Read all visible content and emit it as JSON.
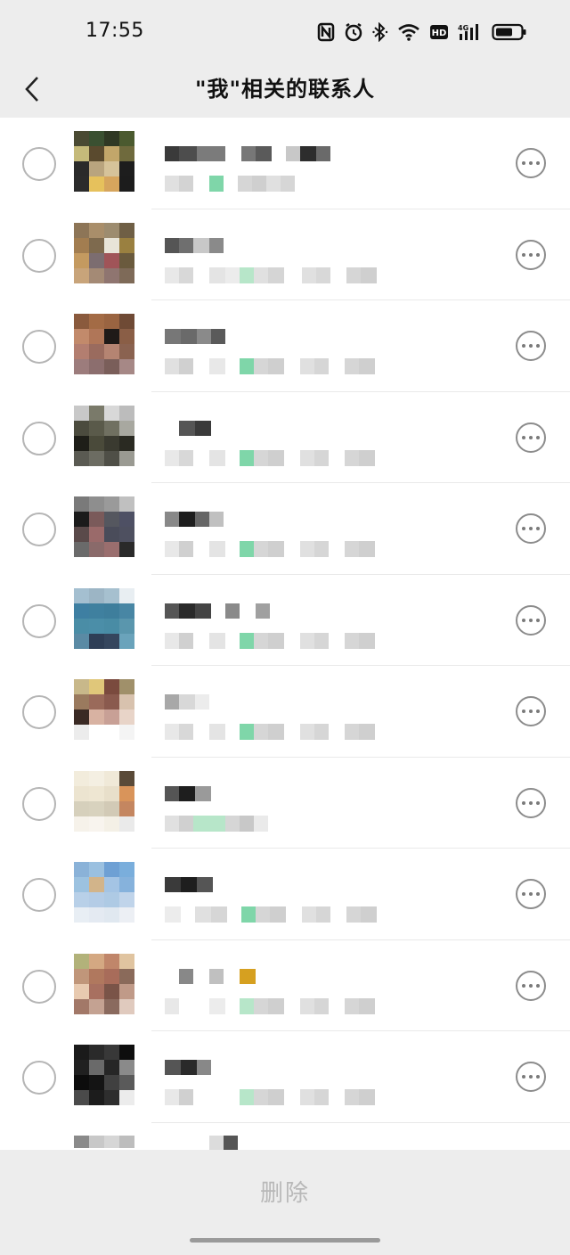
{
  "status_bar": {
    "time": "17:55",
    "icons": [
      "nfc-icon",
      "alarm-icon",
      "bluetooth-icon",
      "wifi-icon",
      "hd-icon",
      "signal-4g-icon",
      "battery-icon"
    ]
  },
  "nav": {
    "back_icon": "chevron-left-icon",
    "title": "\"我\"相关的联系人"
  },
  "contacts": [
    {
      "avatar": [
        "#4a4a33",
        "#3a5031",
        "#2f3824",
        "#4b5a2f",
        "#c5ba7a",
        "#5a4a2e",
        "#c2a66a",
        "#6f6a3d",
        "#2a2a2a",
        "#b9a47e",
        "#d6c39a",
        "#1d1d1d",
        "#2b2b2b",
        "#e6c15c",
        "#d6a55d",
        "#1c1c1c"
      ],
      "name_blocks": [
        [
          "#3a3a3a",
          16
        ],
        [
          "#4d4d4d",
          20
        ],
        [
          "#7b7b7b",
          32
        ],
        [
          "#fff",
          18
        ],
        [
          "#777",
          16
        ],
        [
          "#5a5a5a",
          18
        ],
        [
          "#fff",
          16
        ],
        [
          "#c8c8c8",
          16
        ],
        [
          "#2d2d2d",
          18
        ],
        [
          "#6a6a6a",
          16
        ]
      ],
      "msg_blocks": [
        [
          "#e0e0e0",
          16
        ],
        [
          "#d3d3d3",
          16
        ],
        [
          "#fff",
          18
        ],
        [
          "#7fd6a9",
          16
        ],
        [
          "#fff",
          16
        ],
        [
          "#d6d6d6",
          16
        ],
        [
          "#cfcfcf",
          16
        ],
        [
          "#e0e0e0",
          16
        ],
        [
          "#d6d6d6",
          16
        ]
      ]
    },
    {
      "avatar": [
        "#8d7557",
        "#a98e6a",
        "#9d8c6f",
        "#6f5f45",
        "#a27d50",
        "#7e6a4e",
        "#e8e4d8",
        "#9a8040",
        "#c49a60",
        "#7c6d70",
        "#a05458",
        "#6a5a3d",
        "#c8a47a",
        "#a48a75",
        "#8f7570",
        "#7e6a58"
      ],
      "name_blocks": [
        [
          "#555",
          16
        ],
        [
          "#6f6f6f",
          16
        ],
        [
          "#c8c8c8",
          18
        ],
        [
          "#8a8a8a",
          16
        ]
      ],
      "msg_blocks": [
        [
          "#e8e8e8",
          16
        ],
        [
          "#d8d8d8",
          16
        ],
        [
          "#fff",
          18
        ],
        [
          "#e4e4e4",
          18
        ],
        [
          "#ececec",
          16
        ],
        [
          "#b7e6c9",
          16
        ],
        [
          "#e0e0e0",
          16
        ],
        [
          "#d5d5d5",
          18
        ],
        [
          "#fff",
          20
        ],
        [
          "#e0e0e0",
          16
        ],
        [
          "#d8d8d8",
          16
        ],
        [
          "#fff",
          18
        ],
        [
          "#d6d6d6",
          16
        ],
        [
          "#cfcfcf",
          18
        ]
      ]
    },
    {
      "avatar": [
        "#8a5a3d",
        "#a36b45",
        "#9a6441",
        "#6f4a35",
        "#c28a6b",
        "#b07658",
        "#1f1a18",
        "#8a5e46",
        "#b37e70",
        "#9a6b5e",
        "#b58472",
        "#8a6250",
        "#9c7c7c",
        "#8c6e6e",
        "#7a5e5a",
        "#a68886"
      ],
      "name_blocks": [
        [
          "#777",
          18
        ],
        [
          "#6a6a6a",
          18
        ],
        [
          "#8a8a8a",
          16
        ],
        [
          "#5a5a5a",
          16
        ]
      ],
      "msg_blocks": [
        [
          "#e0e0e0",
          16
        ],
        [
          "#d0d0d0",
          16
        ],
        [
          "#fff",
          18
        ],
        [
          "#e8e8e8",
          18
        ],
        [
          "#fff",
          16
        ],
        [
          "#7fd6a9",
          16
        ],
        [
          "#d6d6d6",
          16
        ],
        [
          "#cfcfcf",
          18
        ],
        [
          "#fff",
          18
        ],
        [
          "#e0e0e0",
          16
        ],
        [
          "#d6d6d6",
          16
        ],
        [
          "#fff",
          18
        ],
        [
          "#d6d6d6",
          16
        ],
        [
          "#cfcfcf",
          18
        ]
      ]
    },
    {
      "avatar": [
        "#c8c8c8",
        "#7a7a6a",
        "#d8d8d8",
        "#bcbcbc",
        "#4b4b3e",
        "#5a5a4a",
        "#707061",
        "#a8a8a0",
        "#1e1e18",
        "#4a4a3a",
        "#3a3a30",
        "#2a2a22",
        "#5a5a52",
        "#6c6c62",
        "#4f4f47",
        "#9a9a92"
      ],
      "name_blocks": [
        [
          "#fff",
          16
        ],
        [
          "#555",
          18
        ],
        [
          "#3a3a3a",
          18
        ]
      ],
      "msg_blocks": [
        [
          "#e8e8e8",
          16
        ],
        [
          "#d8d8d8",
          16
        ],
        [
          "#fff",
          18
        ],
        [
          "#e4e4e4",
          18
        ],
        [
          "#fff",
          16
        ],
        [
          "#7fd6a9",
          16
        ],
        [
          "#d6d6d6",
          16
        ],
        [
          "#cfcfcf",
          18
        ],
        [
          "#fff",
          18
        ],
        [
          "#e0e0e0",
          16
        ],
        [
          "#d6d6d6",
          16
        ],
        [
          "#fff",
          18
        ],
        [
          "#d6d6d6",
          16
        ],
        [
          "#cfcfcf",
          18
        ]
      ]
    },
    {
      "avatar": [
        "#7a7a7a",
        "#8e8e8e",
        "#9a9a9a",
        "#c0c0c0",
        "#1b1b1b",
        "#7a5a5a",
        "#55575f",
        "#4e5064",
        "#5a4a4a",
        "#9a6a6a",
        "#4a4c5a",
        "#4e5060",
        "#6a6a6a",
        "#8a6a6a",
        "#9a6e6e",
        "#2a2a2a"
      ],
      "name_blocks": [
        [
          "#888",
          16
        ],
        [
          "#1e1e1e",
          18
        ],
        [
          "#666",
          16
        ],
        [
          "#c0c0c0",
          16
        ]
      ],
      "msg_blocks": [
        [
          "#e8e8e8",
          16
        ],
        [
          "#d0d0d0",
          16
        ],
        [
          "#fff",
          18
        ],
        [
          "#e4e4e4",
          18
        ],
        [
          "#fff",
          16
        ],
        [
          "#7fd6a9",
          16
        ],
        [
          "#d6d6d6",
          16
        ],
        [
          "#cfcfcf",
          18
        ],
        [
          "#fff",
          18
        ],
        [
          "#e0e0e0",
          16
        ],
        [
          "#d6d6d6",
          16
        ],
        [
          "#fff",
          18
        ],
        [
          "#d6d6d6",
          16
        ],
        [
          "#cfcfcf",
          18
        ]
      ]
    },
    {
      "avatar": [
        "#a4bfd0",
        "#9cb5c5",
        "#a6c0cf",
        "#e8eef2",
        "#3e7fa2",
        "#3f809f",
        "#3e7e9c",
        "#4886a4",
        "#4a8da6",
        "#4b8ea8",
        "#498ca5",
        "#5a96ad",
        "#5a8aa4",
        "#2e3e56",
        "#35465e",
        "#6aa3bb"
      ],
      "name_blocks": [
        [
          "#555",
          16
        ],
        [
          "#2a2a2a",
          18
        ],
        [
          "#444",
          18
        ],
        [
          "#fff",
          16
        ],
        [
          "#8a8a8a",
          16
        ],
        [
          "#fff",
          18
        ],
        [
          "#a0a0a0",
          16
        ]
      ],
      "msg_blocks": [
        [
          "#e8e8e8",
          16
        ],
        [
          "#d0d0d0",
          16
        ],
        [
          "#fff",
          18
        ],
        [
          "#e4e4e4",
          18
        ],
        [
          "#fff",
          16
        ],
        [
          "#7fd6a9",
          16
        ],
        [
          "#d6d6d6",
          16
        ],
        [
          "#cfcfcf",
          18
        ],
        [
          "#fff",
          18
        ],
        [
          "#e0e0e0",
          16
        ],
        [
          "#d6d6d6",
          16
        ],
        [
          "#fff",
          18
        ],
        [
          "#d6d6d6",
          16
        ],
        [
          "#cfcfcf",
          18
        ]
      ]
    },
    {
      "avatar": [
        "#c8b88a",
        "#e0c77a",
        "#7a4a3e",
        "#a0906a",
        "#9a7a5e",
        "#9a6a5a",
        "#8a5a4e",
        "#d8c2ae",
        "#3a2a24",
        "#d8b2a2",
        "#c8a096",
        "#e8d4c8",
        "#ececec",
        "#ffffff",
        "#ffffff",
        "#f4f4f4"
      ],
      "name_blocks": [
        [
          "#a8a8a8",
          16
        ],
        [
          "#d8d8d8",
          18
        ],
        [
          "#ececec",
          16
        ]
      ],
      "msg_blocks": [
        [
          "#e8e8e8",
          16
        ],
        [
          "#d8d8d8",
          16
        ],
        [
          "#fff",
          18
        ],
        [
          "#e4e4e4",
          18
        ],
        [
          "#fff",
          16
        ],
        [
          "#7fd6a9",
          16
        ],
        [
          "#d6d6d6",
          16
        ],
        [
          "#cfcfcf",
          18
        ],
        [
          "#fff",
          18
        ],
        [
          "#e0e0e0",
          16
        ],
        [
          "#d6d6d6",
          16
        ],
        [
          "#fff",
          18
        ],
        [
          "#d6d6d6",
          16
        ],
        [
          "#cfcfcf",
          18
        ]
      ]
    },
    {
      "avatar": [
        "#f2ecdc",
        "#f4efe2",
        "#f0e9d8",
        "#5a4a38",
        "#ece4d0",
        "#eee6d2",
        "#e8dfca",
        "#d9945a",
        "#d6d0bc",
        "#d8d2be",
        "#d2cab6",
        "#c48660",
        "#f6f2ea",
        "#f8f4ee",
        "#f4f0e6",
        "#eaeaea"
      ],
      "name_blocks": [
        [
          "#555",
          16
        ],
        [
          "#1e1e1e",
          18
        ],
        [
          "#9a9a9a",
          18
        ]
      ],
      "msg_blocks": [
        [
          "#e0e0e0",
          16
        ],
        [
          "#d0d0d0",
          16
        ],
        [
          "#b7e6c9",
          18
        ],
        [
          "#b7e6c9",
          18
        ],
        [
          "#d6d6d6",
          16
        ],
        [
          "#c8c8c8",
          16
        ],
        [
          "#eaeaea",
          16
        ]
      ]
    },
    {
      "avatar": [
        "#8ab2d8",
        "#9ac0e0",
        "#6ea0d4",
        "#7aaedc",
        "#9cc2e0",
        "#d2b48a",
        "#a4c4e4",
        "#86b2dc",
        "#b8d0e8",
        "#b4cce6",
        "#aecae4",
        "#c0d4ea",
        "#e8eef4",
        "#e4eaf2",
        "#e0e8f0",
        "#eceff4"
      ],
      "name_blocks": [
        [
          "#3a3a3a",
          18
        ],
        [
          "#1e1e1e",
          18
        ],
        [
          "#555",
          18
        ]
      ],
      "msg_blocks": [
        [
          "#ececec",
          18
        ],
        [
          "#fff",
          16
        ],
        [
          "#e0e0e0",
          18
        ],
        [
          "#d6d6d6",
          18
        ],
        [
          "#fff",
          16
        ],
        [
          "#7fd6a9",
          16
        ],
        [
          "#d6d6d6",
          16
        ],
        [
          "#cfcfcf",
          18
        ],
        [
          "#fff",
          18
        ],
        [
          "#e0e0e0",
          16
        ],
        [
          "#d6d6d6",
          16
        ],
        [
          "#fff",
          18
        ],
        [
          "#d6d6d6",
          16
        ],
        [
          "#cfcfcf",
          18
        ]
      ]
    },
    {
      "avatar": [
        "#b2b27a",
        "#d4a882",
        "#c0866a",
        "#e0c4a0",
        "#c0967a",
        "#b0785e",
        "#a86c5a",
        "#8a6a5a",
        "#e8cab0",
        "#a87060",
        "#7a5448",
        "#c09a88",
        "#a27868",
        "#c4a292",
        "#8a6a5e",
        "#e0cabe"
      ],
      "name_blocks": [
        [
          "#fff",
          16
        ],
        [
          "#888",
          16
        ],
        [
          "#fff",
          18
        ],
        [
          "#c0c0c0",
          16
        ],
        [
          "#fff",
          18
        ],
        [
          "#d6a020",
          18
        ]
      ],
      "msg_blocks": [
        [
          "#e8e8e8",
          16
        ],
        [
          "#fff",
          16
        ],
        [
          "#fff",
          18
        ],
        [
          "#ececec",
          18
        ],
        [
          "#fff",
          16
        ],
        [
          "#b7e6c9",
          16
        ],
        [
          "#d6d6d6",
          16
        ],
        [
          "#cfcfcf",
          18
        ],
        [
          "#fff",
          18
        ],
        [
          "#e0e0e0",
          16
        ],
        [
          "#d6d6d6",
          16
        ],
        [
          "#fff",
          18
        ],
        [
          "#d6d6d6",
          16
        ],
        [
          "#cfcfcf",
          18
        ]
      ]
    },
    {
      "avatar": [
        "#1a1a1a",
        "#2a2a2a",
        "#383838",
        "#0e0e0e",
        "#202020",
        "#6a6a6a",
        "#262626",
        "#8a8a8a",
        "#0c0c0c",
        "#141414",
        "#404040",
        "#5a5a5a",
        "#4a4a4a",
        "#1c1c1c",
        "#2e2e2e",
        "#ececec"
      ],
      "name_blocks": [
        [
          "#555",
          18
        ],
        [
          "#2a2a2a",
          18
        ],
        [
          "#888",
          16
        ]
      ],
      "msg_blocks": [
        [
          "#e8e8e8",
          16
        ],
        [
          "#d0d0d0",
          16
        ],
        [
          "#fff",
          18
        ],
        [
          "#fff",
          18
        ],
        [
          "#fff",
          16
        ],
        [
          "#b7e6c9",
          16
        ],
        [
          "#d6d6d6",
          16
        ],
        [
          "#cfcfcf",
          18
        ],
        [
          "#fff",
          18
        ],
        [
          "#e0e0e0",
          16
        ],
        [
          "#d6d6d6",
          16
        ],
        [
          "#fff",
          18
        ],
        [
          "#d6d6d6",
          16
        ],
        [
          "#cfcfcf",
          18
        ]
      ]
    }
  ],
  "partial_row": {
    "avatar": [
      "#8a8a8a",
      "#c8c8c8",
      "#d6d6d6",
      "#bdbdbd"
    ],
    "name_blocks": [
      [
        "#fff",
        16
      ],
      [
        "#fff",
        16
      ],
      [
        "#fff",
        18
      ],
      [
        "#dcdcdc",
        16
      ],
      [
        "#555",
        16
      ]
    ]
  },
  "bottom": {
    "delete_label": "删除"
  },
  "colors": {
    "background": "#ededed",
    "list_background": "#ffffff",
    "disabled_text": "#b8b8b8"
  }
}
